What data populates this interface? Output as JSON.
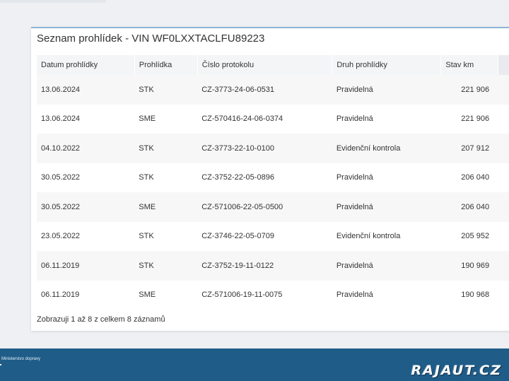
{
  "card": {
    "title": "Seznam prohlídek - VIN WF0LXXTACLFU89223"
  },
  "table": {
    "headers": [
      "Datum prohlídky",
      "Prohlídka",
      "Číslo protokolu",
      "Druh prohlídky",
      "Stav km"
    ],
    "rows": [
      {
        "date": "13.06.2024",
        "type": "STK",
        "protocol": "CZ-3773-24-06-0531",
        "kind": "Pravidelná",
        "km": "221 906"
      },
      {
        "date": "13.06.2024",
        "type": "SME",
        "protocol": "CZ-570416-24-06-0374",
        "kind": "Pravidelná",
        "km": "221 906"
      },
      {
        "date": "04.10.2022",
        "type": "STK",
        "protocol": "CZ-3773-22-10-0100",
        "kind": "Evidenční kontrola",
        "km": "207 912"
      },
      {
        "date": "30.05.2022",
        "type": "STK",
        "protocol": "CZ-3752-22-05-0896",
        "kind": "Pravidelná",
        "km": "206 040"
      },
      {
        "date": "30.05.2022",
        "type": "SME",
        "protocol": "CZ-571006-22-05-0500",
        "kind": "Pravidelná",
        "km": "206 040"
      },
      {
        "date": "23.05.2022",
        "type": "STK",
        "protocol": "CZ-3746-22-05-0709",
        "kind": "Evidenční kontrola",
        "km": "205 952"
      },
      {
        "date": "06.11.2019",
        "type": "STK",
        "protocol": "CZ-3752-19-11-0122",
        "kind": "Pravidelná",
        "km": "190 969"
      },
      {
        "date": "06.11.2019",
        "type": "SME",
        "protocol": "CZ-571006-19-11-0075",
        "kind": "Pravidelná",
        "km": "190 968"
      }
    ]
  },
  "footer": {
    "info": "Zobrazuji 1 až 8 z celkem 8 záznamů"
  },
  "bottom_bar": {
    "ministry": "Ministerstvo dopravy",
    "watermark": "RAJAUT.CZ"
  },
  "colors": {
    "bottom_bar": "#1f5c88",
    "card_accent": "#8fb4d9"
  }
}
